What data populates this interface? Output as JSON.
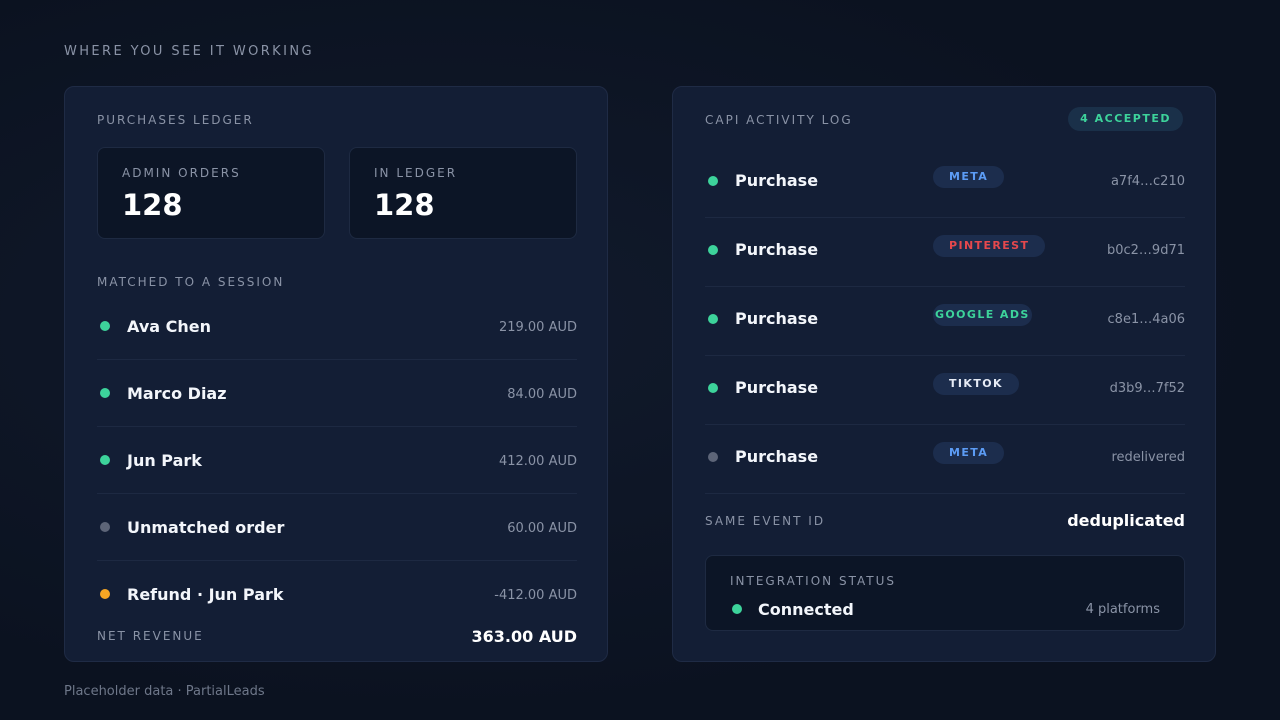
{
  "header": {
    "eyebrow": "WHERE YOU SEE IT WORKING"
  },
  "footer": {
    "note": "Placeholder data · PartialLeads"
  },
  "colors": {
    "green": "#3dd39b",
    "gray": "#5d6578",
    "amber": "#f5a524",
    "meta": "#5c9cf5",
    "pinterest": "#e5484d",
    "google": "#3dd39b",
    "tiktok": "#e6ebf5"
  },
  "ledger": {
    "title": "PURCHASES LEDGER",
    "admin_orders": {
      "label": "ADMIN ORDERS",
      "value": "128"
    },
    "in_ledger": {
      "label": "IN LEDGER",
      "value": "128"
    },
    "matched_label": "MATCHED TO A SESSION",
    "rows": [
      {
        "name": "Ava Chen",
        "amount": "219.00 AUD",
        "status": "green"
      },
      {
        "name": "Marco Diaz",
        "amount": "84.00 AUD",
        "status": "green"
      },
      {
        "name": "Jun Park",
        "amount": "412.00 AUD",
        "status": "green"
      },
      {
        "name": "Unmatched order",
        "amount": "60.00 AUD",
        "status": "gray"
      },
      {
        "name": "Refund · Jun Park",
        "amount": "-412.00 AUD",
        "status": "amber"
      }
    ],
    "net_label": "NET REVENUE",
    "net_value": "363.00 AUD"
  },
  "capi": {
    "title": "CAPI ACTIVITY LOG",
    "accepted_badge": "4 ACCEPTED",
    "events": [
      {
        "name": "Purchase",
        "platform": "META",
        "platform_color": "meta",
        "event_id": "a7f4…c210",
        "status": "green"
      },
      {
        "name": "Purchase",
        "platform": "PINTEREST",
        "platform_color": "pinterest",
        "event_id": "b0c2…9d71",
        "status": "green"
      },
      {
        "name": "Purchase",
        "platform": "GOOGLE ADS",
        "platform_color": "google",
        "event_id": "c8e1…4a06",
        "status": "green"
      },
      {
        "name": "Purchase",
        "platform": "TIKTOK",
        "platform_color": "tiktok",
        "event_id": "d3b9…7f52",
        "status": "green"
      },
      {
        "name": "Purchase",
        "platform": "META",
        "platform_color": "meta",
        "event_id": "redelivered",
        "status": "gray"
      }
    ],
    "same_event_label": "SAME EVENT ID",
    "same_event_value": "deduplicated",
    "integration": {
      "label": "INTEGRATION STATUS",
      "status": "Connected",
      "platforms": "4 platforms"
    }
  }
}
